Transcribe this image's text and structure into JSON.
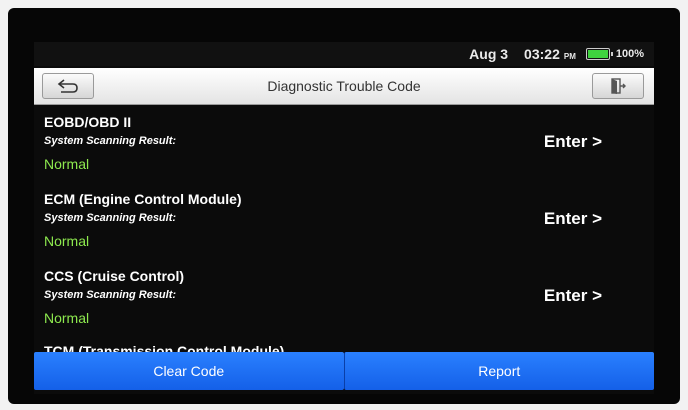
{
  "status_bar": {
    "date": "Aug 3",
    "time": "03:22",
    "ampm": "PM",
    "battery_level": "100%"
  },
  "header": {
    "title": "Diagnostic Trouble Code",
    "back_icon": "back-arrow-icon",
    "exit_icon": "exit-door-icon"
  },
  "items": [
    {
      "name": "EOBD/OBD II",
      "sub": "System Scanning Result:",
      "status": "Normal",
      "action": "Enter >"
    },
    {
      "name": "ECM (Engine Control Module)",
      "sub": "System Scanning Result:",
      "status": "Normal",
      "action": "Enter >"
    },
    {
      "name": "CCS (Cruise Control)",
      "sub": "System Scanning Result:",
      "status": "Normal",
      "action": "Enter >"
    },
    {
      "name": "TCM (Transmission Control Module)"
    }
  ],
  "bottom": {
    "clear_label": "Clear Code",
    "report_label": "Report"
  },
  "colors": {
    "status_ok": "#8eea4f",
    "button_blue": "#1f6ff5"
  }
}
